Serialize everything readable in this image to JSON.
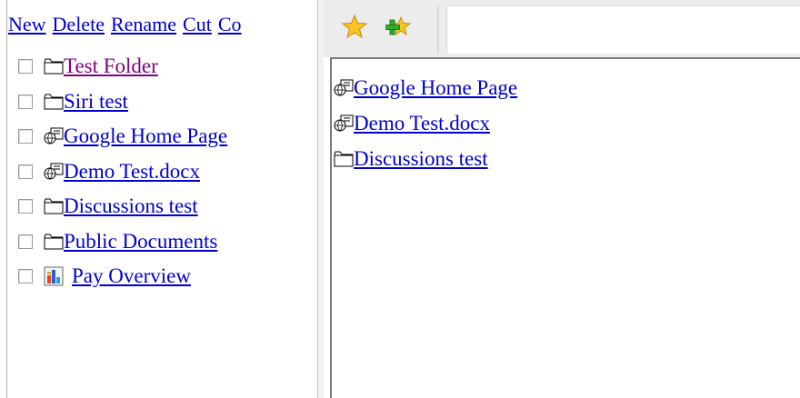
{
  "toolbar": {
    "new": "New",
    "delete": "Delete",
    "rename": "Rename",
    "cut": "Cut",
    "copy": "Co"
  },
  "tree": [
    {
      "icon": "folder-icon",
      "label": " Test  Folder",
      "visited": true
    },
    {
      "icon": "folder-icon",
      "label": "Siri  test",
      "visited": false
    },
    {
      "icon": "web-link-icon",
      "label": " Google Home Page",
      "visited": false
    },
    {
      "icon": "web-link-icon",
      "label": "Demo Test.docx",
      "visited": false
    },
    {
      "icon": "folder-icon",
      "label": "Discussions  test",
      "visited": false
    },
    {
      "icon": "folder-icon",
      "label": "Public Documents",
      "visited": false
    },
    {
      "icon": "chart-icon",
      "label": "Pay Overview",
      "visited": false
    }
  ],
  "right_panel": {
    "address": "",
    "items": [
      {
        "icon": "web-link-icon",
        "label": " Google Home Page"
      },
      {
        "icon": "web-link-icon",
        "label": "Demo Test.docx"
      },
      {
        "icon": "folder-icon",
        "label": "Discussions  test"
      }
    ]
  },
  "colors": {
    "link": "#0000cc",
    "visited": "#800080",
    "toolbar_bg": "#ececec"
  }
}
